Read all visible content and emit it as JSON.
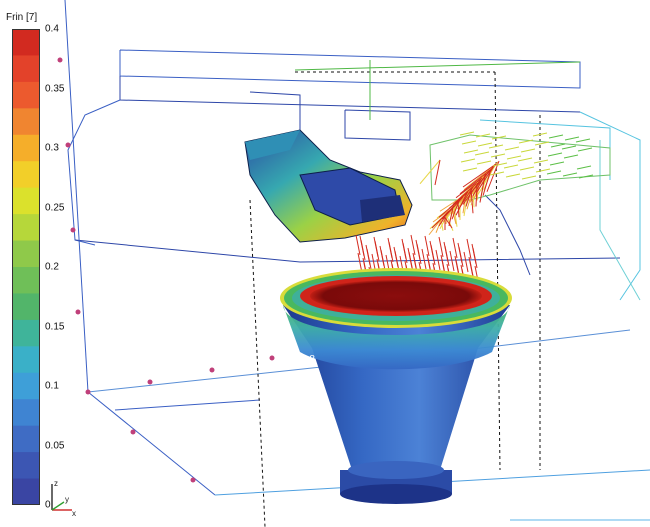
{
  "colorbar": {
    "title": "Frin [7]",
    "ticks": [
      "0.4",
      "0.35",
      "0.3",
      "0.25",
      "0.2",
      "0.15",
      "0.1",
      "0.05",
      "0"
    ],
    "colors": [
      "#d22a20",
      "#e3422a",
      "#ec5a2e",
      "#f08530",
      "#f5ae2a",
      "#f2cf29",
      "#dbe12c",
      "#b6d73a",
      "#8fc94a",
      "#6fbf58",
      "#52b56a",
      "#3fb49a",
      "#3ab0c8",
      "#3e9fd8",
      "#3f84d2",
      "#3f6cc4",
      "#3c56b3",
      "#3a45a3"
    ]
  },
  "point_label": "7.8",
  "axes_icon": {
    "x": "x",
    "y": "y",
    "z": "z"
  },
  "colors": {
    "hopper_inner": "#8b0d0d",
    "hopper_body": "#2c4fa8",
    "ring_green": "#49b85f",
    "ring_yellow": "#d6d935",
    "vector_red": "#d32a1e",
    "dot_magenta": "#c0407a",
    "frame_blue": "#2c3f9c"
  }
}
